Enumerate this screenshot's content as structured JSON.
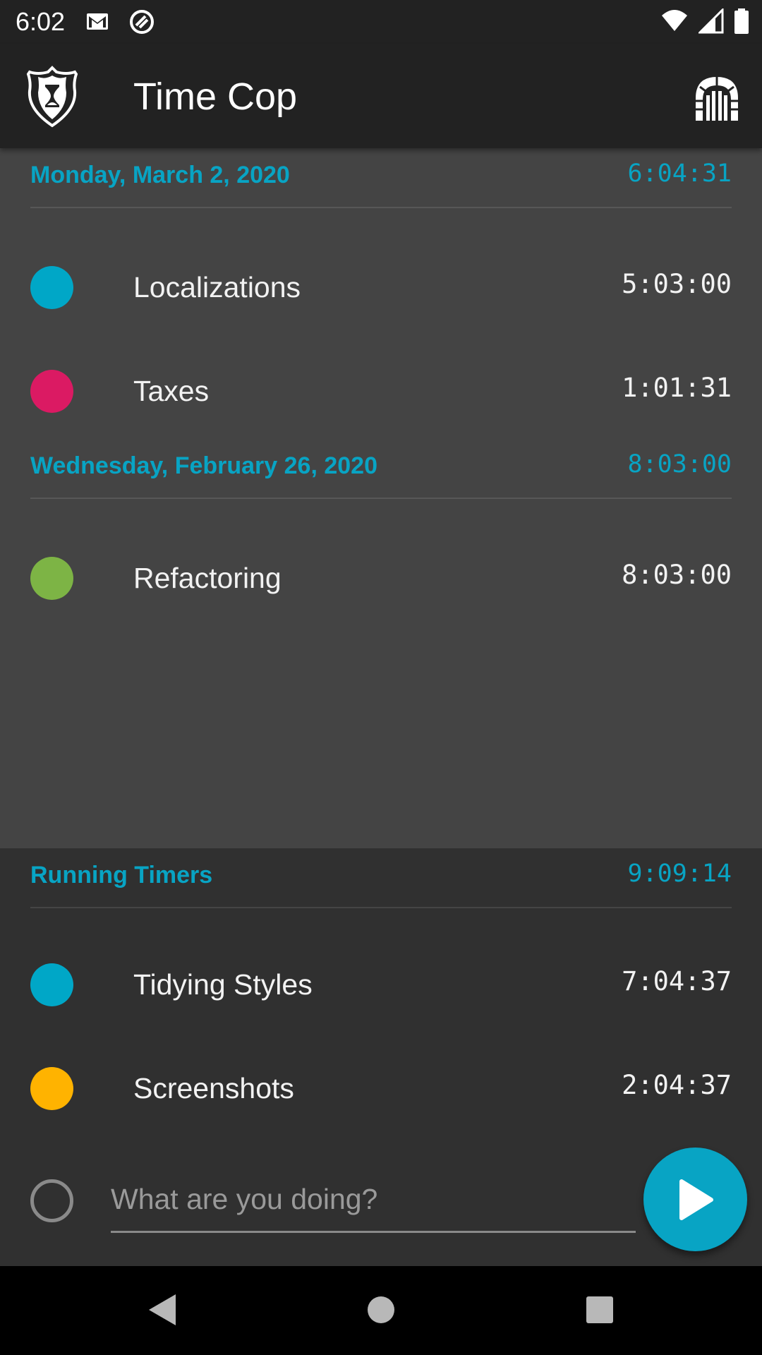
{
  "status_bar": {
    "time": "6:02",
    "left_icons": [
      "gmail-icon",
      "sync-icon"
    ],
    "right_icons": [
      "wifi-icon",
      "signal-icon",
      "battery-icon"
    ]
  },
  "app_bar": {
    "title": "Time Cop",
    "logo_icon": "badge-hourglass-icon",
    "action_icon": "archway-icon"
  },
  "history": [
    {
      "date": "Monday, March 2, 2020",
      "total": "6:04:31",
      "entries": [
        {
          "name": "Localizations",
          "duration": "5:03:00",
          "color": "#00a7c7"
        },
        {
          "name": "Taxes",
          "duration": "1:01:31",
          "color": "#db1a63"
        }
      ]
    },
    {
      "date": "Wednesday, February 26, 2020",
      "total": "8:03:00",
      "entries": [
        {
          "name": "Refactoring",
          "duration": "8:03:00",
          "color": "#7db445"
        }
      ]
    }
  ],
  "running": {
    "title": "Running Timers",
    "total": "9:09:14",
    "entries": [
      {
        "name": "Tidying Styles",
        "duration": "7:04:37",
        "color": "#00a7c7"
      },
      {
        "name": "Screenshots",
        "duration": "2:04:37",
        "color": "#ffb300"
      }
    ]
  },
  "new_timer": {
    "placeholder": "What are you doing?",
    "value": ""
  },
  "colors": {
    "accent": "#08a4c4",
    "app_bar": "#222222",
    "history_bg": "#444444",
    "running_bg": "#303030"
  },
  "nav_bar": {
    "icons": [
      "back-icon",
      "home-icon",
      "recents-icon"
    ]
  }
}
